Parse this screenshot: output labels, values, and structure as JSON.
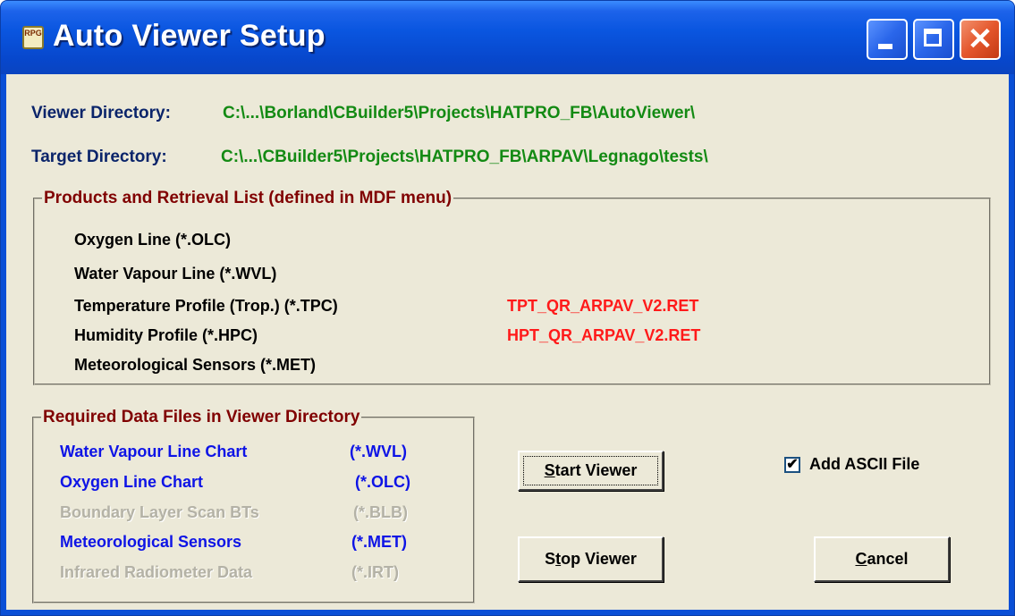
{
  "window": {
    "title": "Auto Viewer Setup",
    "app_icon_text": "RPG"
  },
  "titlebar_buttons": {
    "minimize": "minimize-icon",
    "maximize": "maximize-icon",
    "close": "close-icon",
    "close_glyph": "✕"
  },
  "directories": {
    "viewer_label": "Viewer Directory:",
    "viewer_value": "C:\\...\\Borland\\CBuilder5\\Projects\\HATPRO_FB\\AutoViewer\\",
    "target_label": "Target Directory:",
    "target_value": "C:\\...\\CBuilder5\\Projects\\HATPRO_FB\\ARPAV\\Legnago\\tests\\"
  },
  "products": {
    "legend": "Products and Retrieval List (defined in MDF menu)",
    "items": [
      {
        "label": "Oxygen Line (*.OLC)",
        "retrieval": ""
      },
      {
        "label": "Water Vapour Line (*.WVL)",
        "retrieval": ""
      },
      {
        "label": "Temperature Profile (Trop.) (*.TPC)",
        "retrieval": "TPT_QR_ARPAV_V2.RET"
      },
      {
        "label": "Humidity Profile (*.HPC)",
        "retrieval": "HPT_QR_ARPAV_V2.RET"
      },
      {
        "label": "Meteorological Sensors (*.MET)",
        "retrieval": ""
      }
    ]
  },
  "required_files": {
    "legend": "Required Data Files in Viewer Directory",
    "items": [
      {
        "name": "Water Vapour Line  Chart",
        "ext": "(*.WVL)",
        "enabled": true
      },
      {
        "name": "Oxygen Line Chart",
        "ext": "(*.OLC)",
        "enabled": true
      },
      {
        "name": "Boundary Layer Scan BTs",
        "ext": "(*.BLB)",
        "enabled": false
      },
      {
        "name": "Meteorological Sensors",
        "ext": "(*.MET)",
        "enabled": true
      },
      {
        "name": "Infrared Radiometer Data",
        "ext": "(*.IRT)",
        "enabled": false
      }
    ]
  },
  "buttons": {
    "start_key": "S",
    "start_rest": "tart Viewer",
    "stop_pre": "S",
    "stop_key": "t",
    "stop_rest": "op Viewer",
    "cancel_key": "C",
    "cancel_rest": "ancel"
  },
  "options": {
    "add_ascii_label": "Add ASCII File",
    "add_ascii_checked": true,
    "check_glyph": "✔"
  }
}
